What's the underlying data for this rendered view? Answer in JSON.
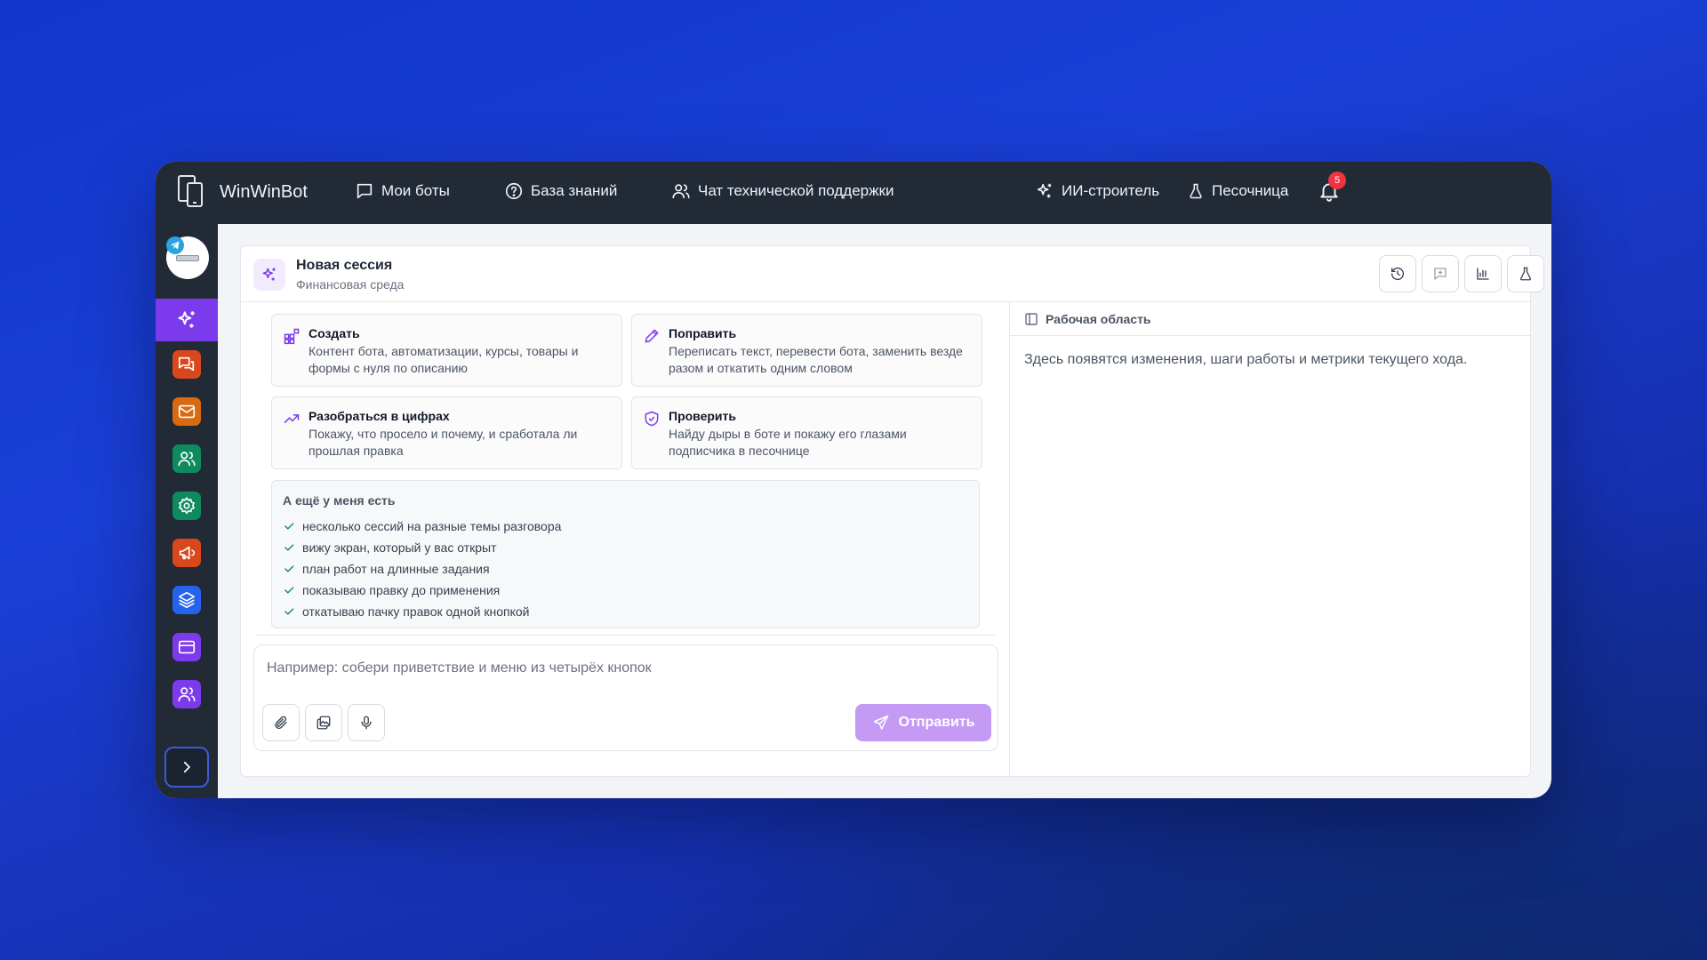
{
  "app": {
    "name": "WinWinBot"
  },
  "nav": {
    "my_bots": "Мои боты",
    "knowledge_base": "База знаний",
    "support_chat": "Чат технической поддержки",
    "ai_builder": "ИИ-строитель",
    "sandbox": "Песочница",
    "notifications_count": "5"
  },
  "sidebar": {
    "items": [
      {
        "icon": "sparkles-icon",
        "color": "#7c3aed",
        "active": true
      },
      {
        "icon": "chats-icon",
        "color": "#d9481c"
      },
      {
        "icon": "mail-icon",
        "color": "#d86a12"
      },
      {
        "icon": "users-icon",
        "color": "#0f8a5f"
      },
      {
        "icon": "gear-icon",
        "color": "#0f8a5f"
      },
      {
        "icon": "megaphone-icon",
        "color": "#d9481c"
      },
      {
        "icon": "layers-icon",
        "color": "#2563eb"
      },
      {
        "icon": "card-icon",
        "color": "#7c3aed"
      },
      {
        "icon": "users-icon",
        "color": "#7c3aed"
      }
    ]
  },
  "session": {
    "title": "Новая сессия",
    "subtitle": "Финансовая среда"
  },
  "actions": [
    {
      "title": "Создать",
      "desc": "Контент бота, автоматизации, курсы, товары и формы с нуля по описанию",
      "icon": "grid-plus-icon"
    },
    {
      "title": "Поправить",
      "desc": "Переписать текст, перевести бота, заменить везде разом и откатить одним словом",
      "icon": "pencil-icon"
    },
    {
      "title": "Разобраться в цифрах",
      "desc": "Покажу, что просело и почему, и сработала ли прошлая правка",
      "icon": "trend-up-icon"
    },
    {
      "title": "Проверить",
      "desc": "Найду дыры в боте и покажу его глазами подписчика в песочнице",
      "icon": "shield-check-icon"
    }
  ],
  "more": {
    "title": "А ещё у меня есть",
    "items": [
      "несколько сессий на разные темы разговора",
      "вижу экран, который у вас открыт",
      "план работ на длинные задания",
      "показываю правку до применения",
      "откатываю пачку правок одной кнопкой"
    ]
  },
  "composer": {
    "placeholder": "Например: собери приветствие и меню из четырёх кнопок",
    "send_label": "Отправить"
  },
  "workspace": {
    "title": "Рабочая область",
    "empty_text": "Здесь появятся изменения, шаги работы и метрики текущего хода."
  },
  "colors": {
    "accent": "#7c3aed",
    "send_button": "#c49af5",
    "topbar": "#222a35",
    "badge": "#ef3340"
  }
}
